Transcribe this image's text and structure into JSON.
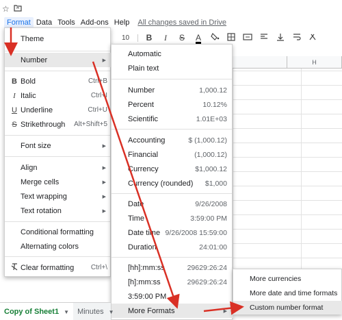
{
  "top_icons": {
    "star": "☆",
    "folder": "🗀"
  },
  "menubar": {
    "items": [
      "Format",
      "Data",
      "Tools",
      "Add-ons",
      "Help"
    ],
    "saved_status": "All changes saved in Drive",
    "active_color": "#1a73e8"
  },
  "toolbar": {
    "font_size": "10",
    "bold": "B",
    "italic": "I",
    "strike": "S",
    "text_color": "A"
  },
  "column_header": "H",
  "format_menu": {
    "items": [
      {
        "icon": "",
        "label": "Theme",
        "shortcut": ""
      },
      {
        "icon": "",
        "label": "Number",
        "shortcut": ""
      },
      {
        "icon": "B",
        "label": "Bold",
        "shortcut": "Ctrl+B"
      },
      {
        "icon": "I",
        "label": "Italic",
        "shortcut": "Ctrl+I"
      },
      {
        "icon": "U",
        "label": "Underline",
        "shortcut": "Ctrl+U"
      },
      {
        "icon": "S",
        "label": "Strikethrough",
        "shortcut": "Alt+Shift+5"
      },
      {
        "icon": "",
        "label": "Font size",
        "shortcut": ""
      },
      {
        "icon": "",
        "label": "Align",
        "shortcut": ""
      },
      {
        "icon": "",
        "label": "Merge cells",
        "shortcut": ""
      },
      {
        "icon": "",
        "label": "Text wrapping",
        "shortcut": ""
      },
      {
        "icon": "",
        "label": "Text rotation",
        "shortcut": ""
      },
      {
        "icon": "",
        "label": "Conditional formatting",
        "shortcut": ""
      },
      {
        "icon": "",
        "label": "Alternating colors",
        "shortcut": ""
      },
      {
        "icon": "clear-format",
        "label": "Clear formatting",
        "shortcut": "Ctrl+\\"
      }
    ]
  },
  "number_menu": {
    "items": [
      {
        "label": "Automatic",
        "value": ""
      },
      {
        "label": "Plain text",
        "value": ""
      },
      {
        "label": "Number",
        "value": "1,000.12"
      },
      {
        "label": "Percent",
        "value": "10.12%"
      },
      {
        "label": "Scientific",
        "value": "1.01E+03"
      },
      {
        "label": "Accounting",
        "value": "$ (1,000.12)"
      },
      {
        "label": "Financial",
        "value": "(1,000.12)"
      },
      {
        "label": "Currency",
        "value": "$1,000.12"
      },
      {
        "label": "Currency (rounded)",
        "value": "$1,000"
      },
      {
        "label": "Date",
        "value": "9/26/2008"
      },
      {
        "label": "Time",
        "value": "3:59:00 PM"
      },
      {
        "label": "Date time",
        "value": "9/26/2008 15:59:00"
      },
      {
        "label": "Duration",
        "value": "24:01:00"
      },
      {
        "label": "[hh]:mm:ss",
        "value": "29629:26:24"
      },
      {
        "label": "[h]:mm:ss",
        "value": "29629:26:24"
      },
      {
        "label": "3:59:00 PM",
        "value": ""
      },
      {
        "label": "More Formats",
        "value": ""
      }
    ]
  },
  "more_formats_menu": {
    "items": [
      "More currencies",
      "More date and time formats",
      "Custom number format"
    ]
  },
  "sheet_tabs": {
    "active": "Copy of Sheet1",
    "other": "Minutes",
    "active_color": "#188038"
  },
  "annotation_color": "#d93025"
}
